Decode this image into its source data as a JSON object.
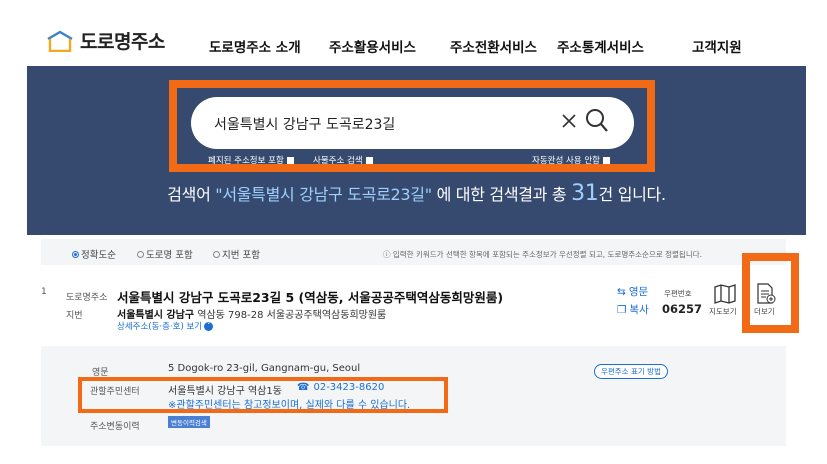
{
  "header": {
    "logo_text": "도로명주소",
    "nav": [
      "도로명주소 소개",
      "주소활용서비스",
      "주소전환서비스",
      "주소통계서비스",
      "고객지원"
    ]
  },
  "search": {
    "value": "서울특별시 강남구 도곡로23길",
    "options": {
      "abolished": "폐지된 주소정보 포함",
      "business": "사물주소 검색",
      "autocomplete": "자동완성 사용 안함"
    },
    "summary": {
      "prefix": "검색어 ",
      "keyword": "\"서울특별시 강남구 도곡로23길\"",
      "middle": " 에 대한 검색결과 총 ",
      "count": "31",
      "suffix": "건 입니다."
    }
  },
  "filter": {
    "options": [
      "정확도순",
      "도로명 포함",
      "지번 포함"
    ],
    "selected": 0,
    "info": "ⓘ 입력한 키워드가 선택한 항목에 포함되는 주소정보가 우선정렬 되고, 도로명주소순으로 정렬됩니다."
  },
  "result": {
    "index": "1",
    "road_label": "도로명주소",
    "road_address": "서울특별시 강남구 도곡로23길 5 (역삼동, 서울공공주택역삼동희망원룸)",
    "jibun_label": "지번",
    "jibun_strong": "서울특별시 강남구",
    "jibun_rest": " 역삼동 798-28 서울공공주택역삼동희망원룸",
    "detail_link": "상세주소(동·층·호) 보기",
    "english_btn": "영문",
    "copy_btn": "복사",
    "postcode_label": "우편번호",
    "postcode": "06257",
    "map_label": "지도보기",
    "more_label": "더보기"
  },
  "detail": {
    "english_label": "영문",
    "english_value": "5 Dogok-ro 23-gil, Gangnam-gu, Seoul",
    "post_method_btn": "우편주소 표기 방법",
    "center_label": "관할주민센터",
    "center_value": "서울특별시 강남구 역삼1동",
    "center_phone": "02-3423-8620",
    "center_note": "※관할주민센터는 참고정보이며, 실제와 다를 수 있습니다.",
    "history_label": "주소변동이력",
    "history_btn": "변동이력검색"
  },
  "colors": {
    "hero_bg": "#354a6e",
    "highlight": "#f26a16",
    "link": "#1a6fd1"
  }
}
